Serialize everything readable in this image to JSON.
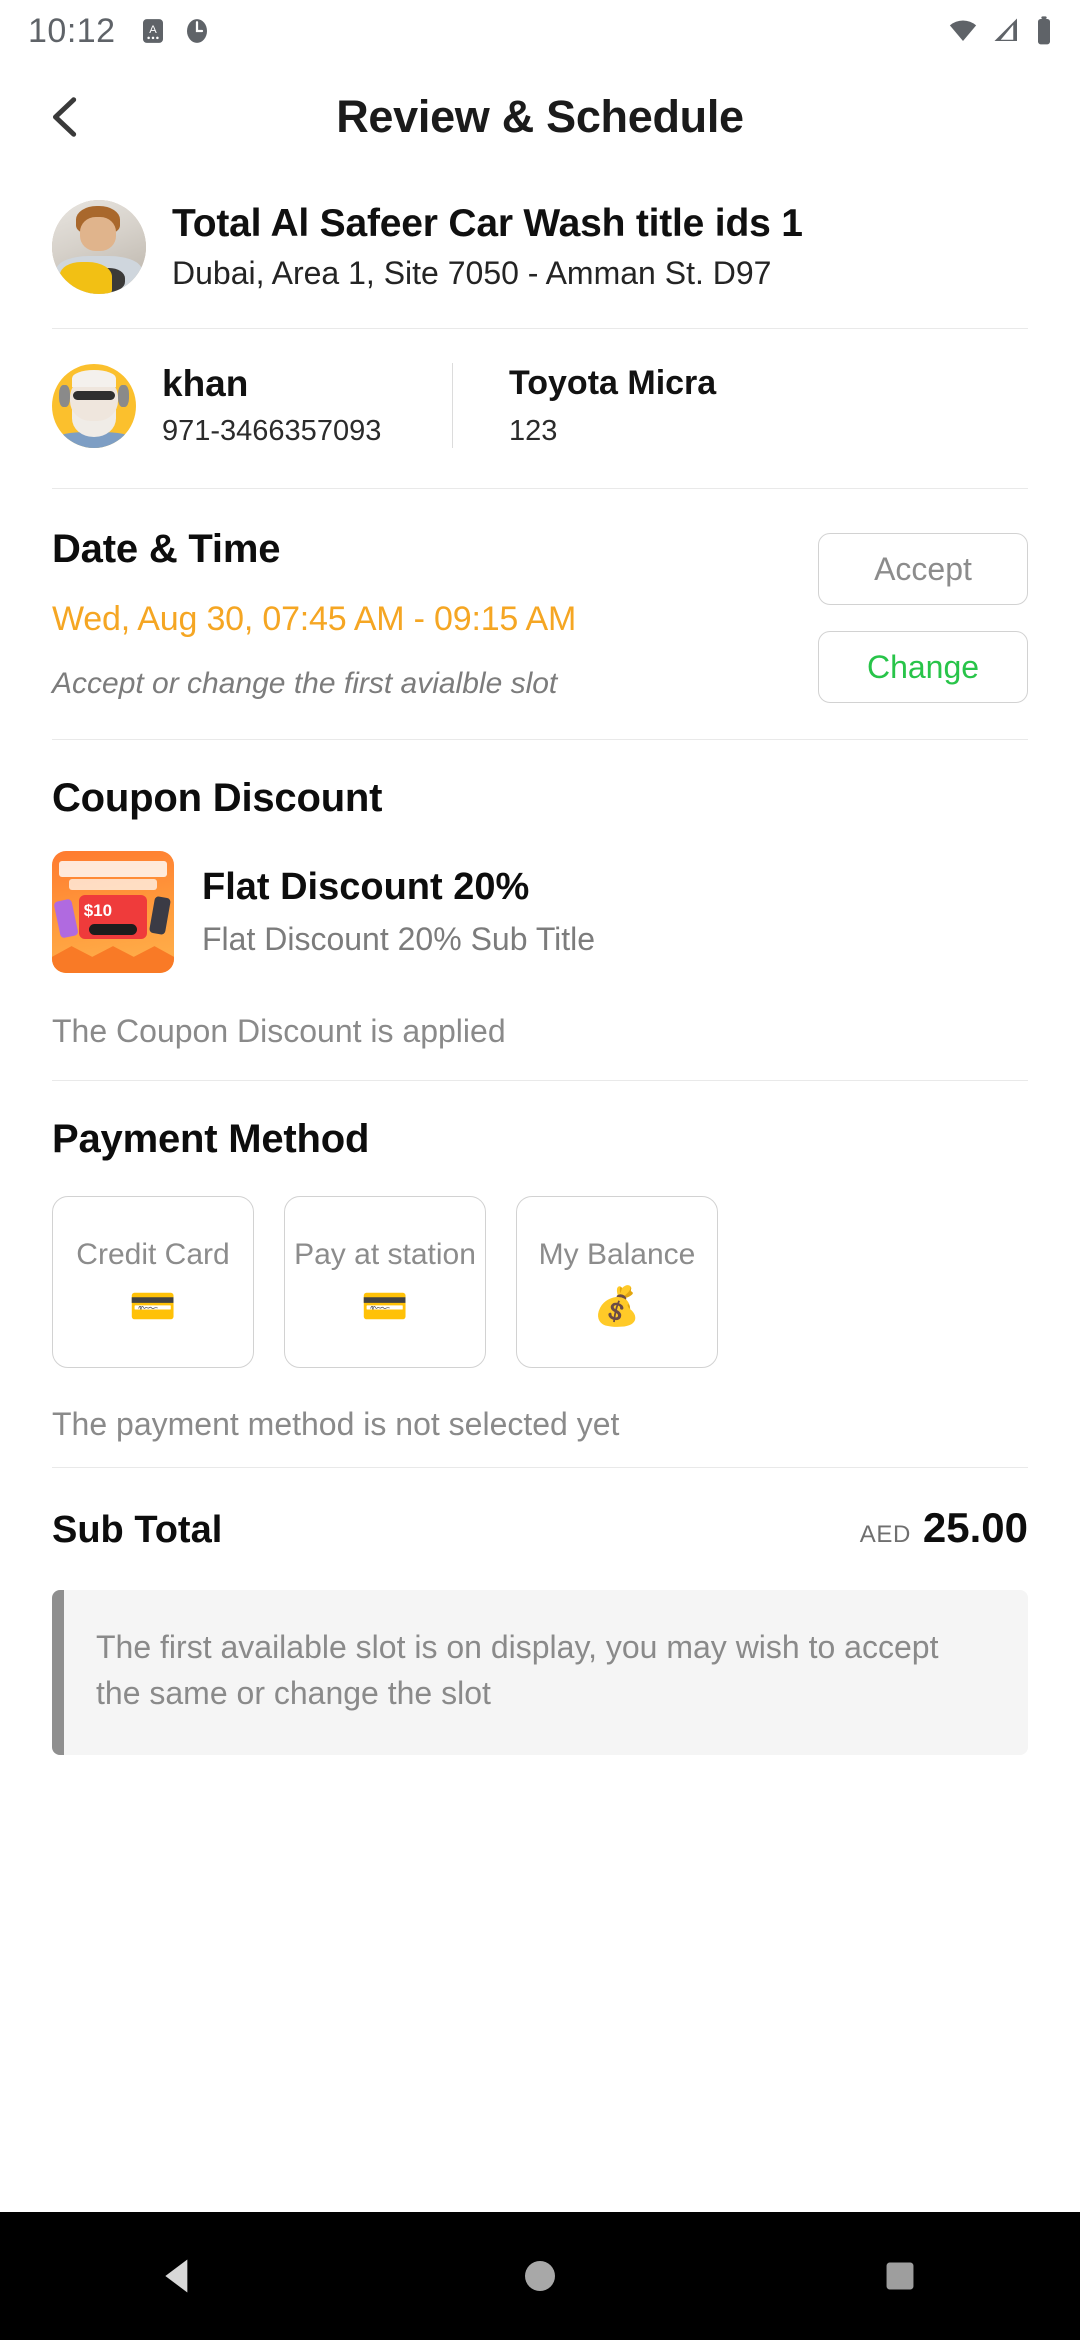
{
  "status_bar": {
    "time": "10:12",
    "left_icons": [
      "app-notification-icon",
      "clock-notification-icon"
    ],
    "right_icons": [
      "wifi-icon",
      "cellular-signal-icon",
      "battery-icon"
    ]
  },
  "header": {
    "back_icon": "chevron-left-icon",
    "title": "Review & Schedule"
  },
  "business": {
    "avatar": "car-wash-worker-photo",
    "name": "Total Al Safeer Car Wash  title ids 1",
    "address": "Dubai, Area 1, Site 7050 - Amman St. D97"
  },
  "customer": {
    "avatar": "customer-photo",
    "name": "khan",
    "phone": "971-3466357093"
  },
  "vehicle": {
    "model": "Toyota Micra",
    "plate": "123"
  },
  "date_time": {
    "title": "Date & Time",
    "slot": "Wed, Aug 30, 07:45 AM - 09:15 AM",
    "slot_color": "#f5a623",
    "hint": "Accept or change the first avialble slot",
    "hint_color": "#7c7c7c",
    "accept_label": "Accept",
    "accept_color": "#8c8c8c",
    "change_label": "Change",
    "change_color": "#28c449"
  },
  "coupon": {
    "title": "Coupon Discount",
    "thumb": "shopping-festival-coupon-image",
    "name": "Flat Discount 20%",
    "subtitle": "Flat Discount 20% Sub Title",
    "note": "The Coupon Discount is applied"
  },
  "payment": {
    "title": "Payment Method",
    "options": [
      {
        "label": "Credit Card",
        "icon": "credit-cards-icon",
        "emoji": "💳"
      },
      {
        "label": "Pay at station",
        "icon": "wallet-card-icon",
        "emoji": "💳"
      },
      {
        "label": "My Balance",
        "icon": "money-wallet-icon",
        "emoji": "💰"
      }
    ],
    "note": "The payment method is not selected yet"
  },
  "totals": {
    "label": "Sub Total",
    "currency": "AED",
    "amount": "25.00"
  },
  "banner": {
    "text": "The first available slot is on display, you may wish to accept the same or change the slot",
    "accent_color": "#8f8f8f"
  },
  "navigation_bar": {
    "back": "nav-back-triangle-icon",
    "home": "nav-home-circle-icon",
    "recents": "nav-recents-square-icon"
  }
}
